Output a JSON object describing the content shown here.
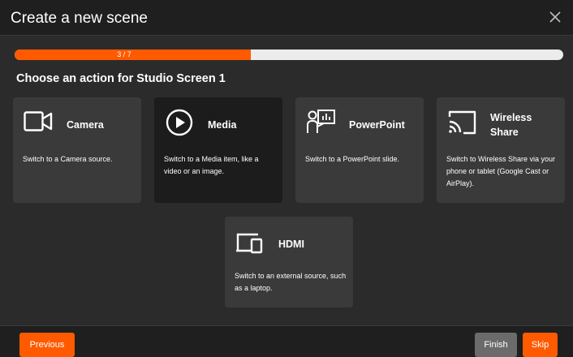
{
  "dialog": {
    "title": "Create a new scene",
    "close_icon": "close-icon"
  },
  "progress": {
    "text": "3 / 7",
    "current": 3,
    "total": 7,
    "fraction": 0.43,
    "fill_color": "#ff5a00",
    "track_color": "#ececec"
  },
  "heading": "Choose an action for Studio Screen 1",
  "cards": [
    {
      "name": "Camera",
      "description": "Switch to a Camera source.",
      "icon": "camera-icon",
      "selected": false
    },
    {
      "name": "Media",
      "description": "Switch to a Media item, like a video or an image.",
      "icon": "play-icon",
      "selected": true
    },
    {
      "name": "PowerPoint",
      "description": "Switch to a PowerPoint slide.",
      "icon": "presenter-icon",
      "selected": false
    },
    {
      "name": "Wireless Share",
      "description": "Switch to Wireless Share via your phone or tablet (Google Cast or AirPlay).",
      "icon": "cast-icon",
      "selected": false
    },
    {
      "name": "HDMI",
      "description": "Switch to an external source, such as a laptop.",
      "icon": "devices-icon",
      "selected": false
    }
  ],
  "footer": {
    "previous_label": "Previous",
    "finish_label": "Finish",
    "skip_label": "Skip"
  },
  "colors": {
    "accent": "#ff5a00",
    "background": "#2b2b2b",
    "card": "#3a3a3a",
    "card_selected": "#1c1c1c",
    "button_gray": "#6b6b6b"
  }
}
